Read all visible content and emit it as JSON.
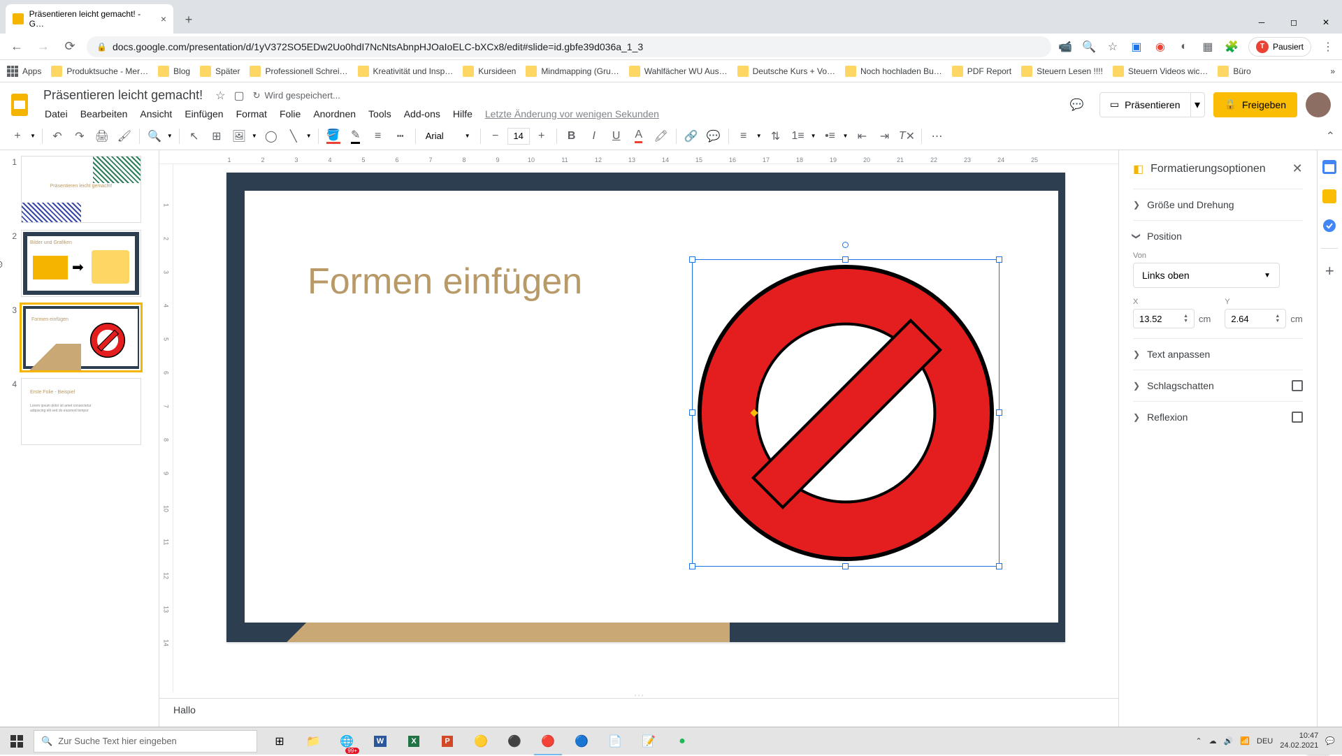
{
  "browser": {
    "tab_title": "Präsentieren leicht gemacht! - G…",
    "url": "docs.google.com/presentation/d/1yV372SO5EDw2Uo0hdI7NcNtsAbnpHJOaIoELC-bXCx8/edit#slide=id.gbfe39d036a_1_3",
    "paused": "Pausiert"
  },
  "bookmarks": {
    "apps": "Apps",
    "items": [
      "Produktsuche - Mer…",
      "Blog",
      "Später",
      "Professionell Schrei…",
      "Kreativität und Insp…",
      "Kursideen",
      "Mindmapping  (Gru…",
      "Wahlfächer WU Aus…",
      "Deutsche Kurs + Vo…",
      "Noch hochladen Bu…",
      "PDF Report",
      "Steuern Lesen !!!!",
      "Steuern Videos wic…",
      "Büro"
    ]
  },
  "doc": {
    "title": "Präsentieren leicht gemacht!",
    "saving": "Wird gespeichert...",
    "last_edit": "Letzte Änderung vor wenigen Sekunden"
  },
  "menus": [
    "Datei",
    "Bearbeiten",
    "Ansicht",
    "Einfügen",
    "Format",
    "Folie",
    "Anordnen",
    "Tools",
    "Add-ons",
    "Hilfe"
  ],
  "header_buttons": {
    "present": "Präsentieren",
    "share": "Freigeben"
  },
  "toolbar": {
    "font": "Arial",
    "font_size": "14"
  },
  "slides": {
    "count": 4,
    "selected": 3
  },
  "canvas": {
    "title_text": "Formen einfügen",
    "notes": "Hallo"
  },
  "format_panel": {
    "title": "Formatierungsoptionen",
    "sections": {
      "size": "Größe und Drehung",
      "position": "Position",
      "text_fit": "Text anpassen",
      "shadow": "Schlagschatten",
      "reflection": "Reflexion"
    },
    "position": {
      "from_label": "Von",
      "from_value": "Links oben",
      "x_label": "X",
      "x_value": "13.52",
      "y_label": "Y",
      "y_value": "2.64",
      "unit": "cm"
    }
  },
  "taskbar": {
    "search_placeholder": "Zur Suche Text hier eingeben",
    "lang": "DEU",
    "time": "10:47",
    "date": "24.02.2021",
    "badge": "99+"
  }
}
